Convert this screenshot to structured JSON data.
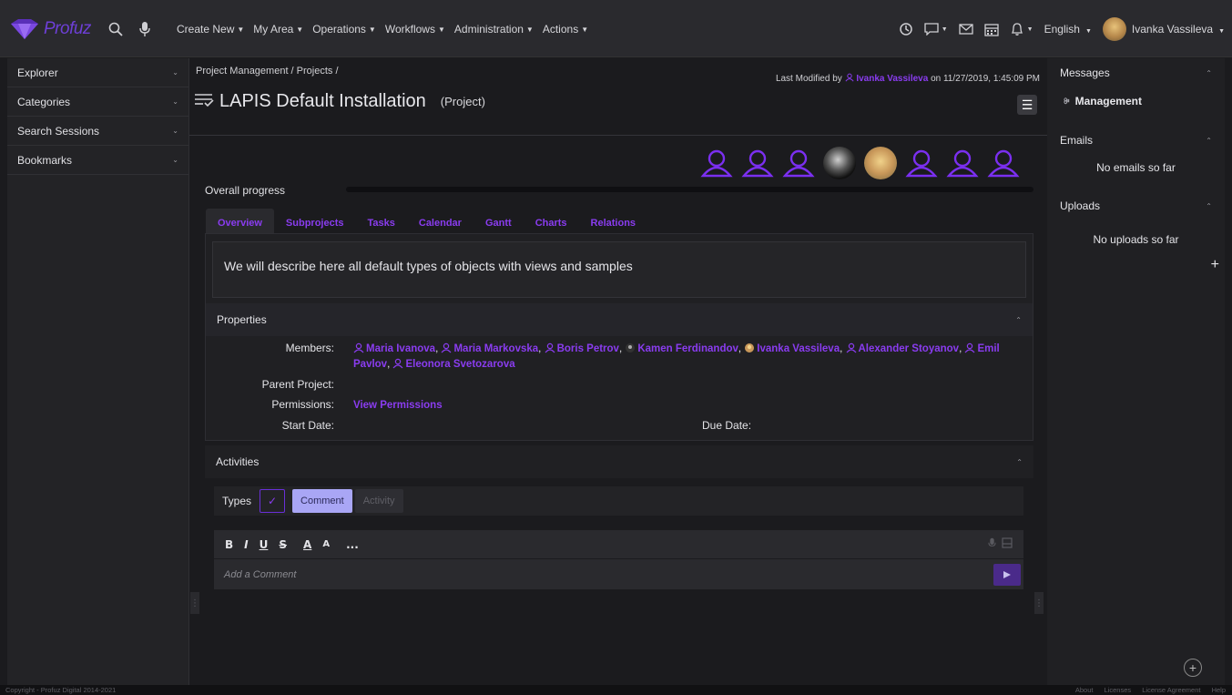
{
  "topbar": {
    "logo_text": "Profuz",
    "menu": [
      {
        "label": "Create New"
      },
      {
        "label": "My Area"
      },
      {
        "label": "Operations"
      },
      {
        "label": "Workflows"
      },
      {
        "label": "Administration"
      },
      {
        "label": "Actions"
      }
    ],
    "language": "English",
    "user_name": "Ivanka Vassileva"
  },
  "left_nav": [
    {
      "label": "Explorer"
    },
    {
      "label": "Categories"
    },
    {
      "label": "Search Sessions"
    },
    {
      "label": "Bookmarks"
    }
  ],
  "main": {
    "breadcrumb": "Project Management / Projects /",
    "modified_prefix": "Last Modified by",
    "modified_user": "Ivanka Vassileva",
    "modified_suffix": "on 11/27/2019, 1:45:09 PM",
    "title": "LAPIS Default Installation",
    "title_type": "(Project)",
    "progress_label": "Overall progress",
    "progress_value": 0,
    "tabs": [
      "Overview",
      "Subprojects",
      "Tasks",
      "Calendar",
      "Gantt",
      "Charts",
      "Relations"
    ],
    "description": "We will describe here all default types of objects with views and samples",
    "properties_title": "Properties",
    "members_label": "Members:",
    "members": [
      "Maria Ivanova",
      "Maria Markovska",
      "Boris Petrov",
      "Kamen Ferdinandov",
      "Ivanka Vassileva",
      "Alexander Stoyanov",
      "Emil Pavlov",
      "Eleonora Svetozarova"
    ],
    "parent_project_label": "Parent Project:",
    "parent_project": "",
    "permissions_label": "Permissions:",
    "permissions_link": "View Permissions",
    "start_date_label": "Start Date:",
    "start_date": "",
    "due_date_label": "Due Date:",
    "due_date": "",
    "activities_title": "Activities",
    "types_label": "Types",
    "comment_btn": "Comment",
    "activity_btn": "Activity",
    "format_buttons": [
      "B",
      "I",
      "U",
      "S",
      "A",
      "A",
      "..."
    ],
    "comment_placeholder": "Add a Comment"
  },
  "right_panel": {
    "messages_title": "Messages",
    "management": "Management",
    "emails_title": "Emails",
    "emails_empty": "No emails so far",
    "uploads_title": "Uploads",
    "uploads_empty": "No uploads so far"
  },
  "footer": {
    "copyright": "Copyright - Profuz Digital 2014-2021",
    "links": [
      "About",
      "Licenses",
      "License Agreement",
      "Help"
    ]
  },
  "colors": {
    "accent": "#8a3cf0",
    "accent_dark": "#6a2fd8",
    "background": "#1b1b1e"
  }
}
